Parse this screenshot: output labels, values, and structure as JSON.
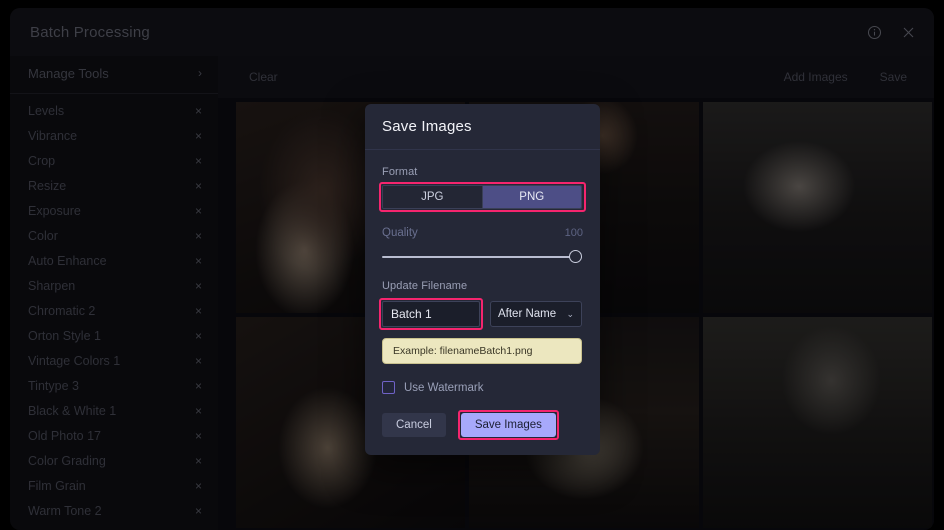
{
  "window": {
    "title": "Batch Processing",
    "info_icon": "info-circle-icon",
    "close_icon": "close-icon"
  },
  "sidebar": {
    "header": {
      "label": "Manage Tools",
      "chevron": "›"
    },
    "remove_glyph": "×",
    "tools": [
      {
        "label": "Levels"
      },
      {
        "label": "Vibrance"
      },
      {
        "label": "Crop"
      },
      {
        "label": "Resize"
      },
      {
        "label": "Exposure"
      },
      {
        "label": "Color"
      },
      {
        "label": "Auto Enhance"
      },
      {
        "label": "Sharpen"
      },
      {
        "label": "Chromatic 2"
      },
      {
        "label": "Orton Style 1"
      },
      {
        "label": "Vintage Colors 1"
      },
      {
        "label": "Tintype 3"
      },
      {
        "label": "Black & White 1"
      },
      {
        "label": "Old Photo 17"
      },
      {
        "label": "Color Grading"
      },
      {
        "label": "Film Grain"
      },
      {
        "label": "Warm Tone 2"
      }
    ]
  },
  "toolbar": {
    "clear_label": "Clear",
    "add_images_label": "Add Images",
    "save_label": "Save"
  },
  "grid": {
    "thumbnails": [
      {
        "name": "thumbnail-1"
      },
      {
        "name": "thumbnail-2"
      },
      {
        "name": "thumbnail-3"
      },
      {
        "name": "thumbnail-4"
      },
      {
        "name": "thumbnail-5"
      },
      {
        "name": "thumbnail-6"
      }
    ]
  },
  "dialog": {
    "title": "Save Images",
    "format": {
      "label": "Format",
      "options": [
        "JPG",
        "PNG"
      ],
      "selected": "PNG"
    },
    "quality": {
      "label": "Quality",
      "value": "100"
    },
    "filename": {
      "label": "Update Filename",
      "input_value": "Batch 1",
      "input_placeholder": "Batch 1",
      "position_value": "After Name",
      "chevron": "⌄",
      "example": "Example: filenameBatch1.png"
    },
    "watermark": {
      "label": "Use Watermark"
    },
    "buttons": {
      "cancel": "Cancel",
      "save": "Save Images"
    }
  },
  "colors": {
    "highlight": "#f5256e",
    "accent": "#a7a9fb",
    "segment_selected": "#4d4e86",
    "hint_bg": "#ece7bf"
  }
}
